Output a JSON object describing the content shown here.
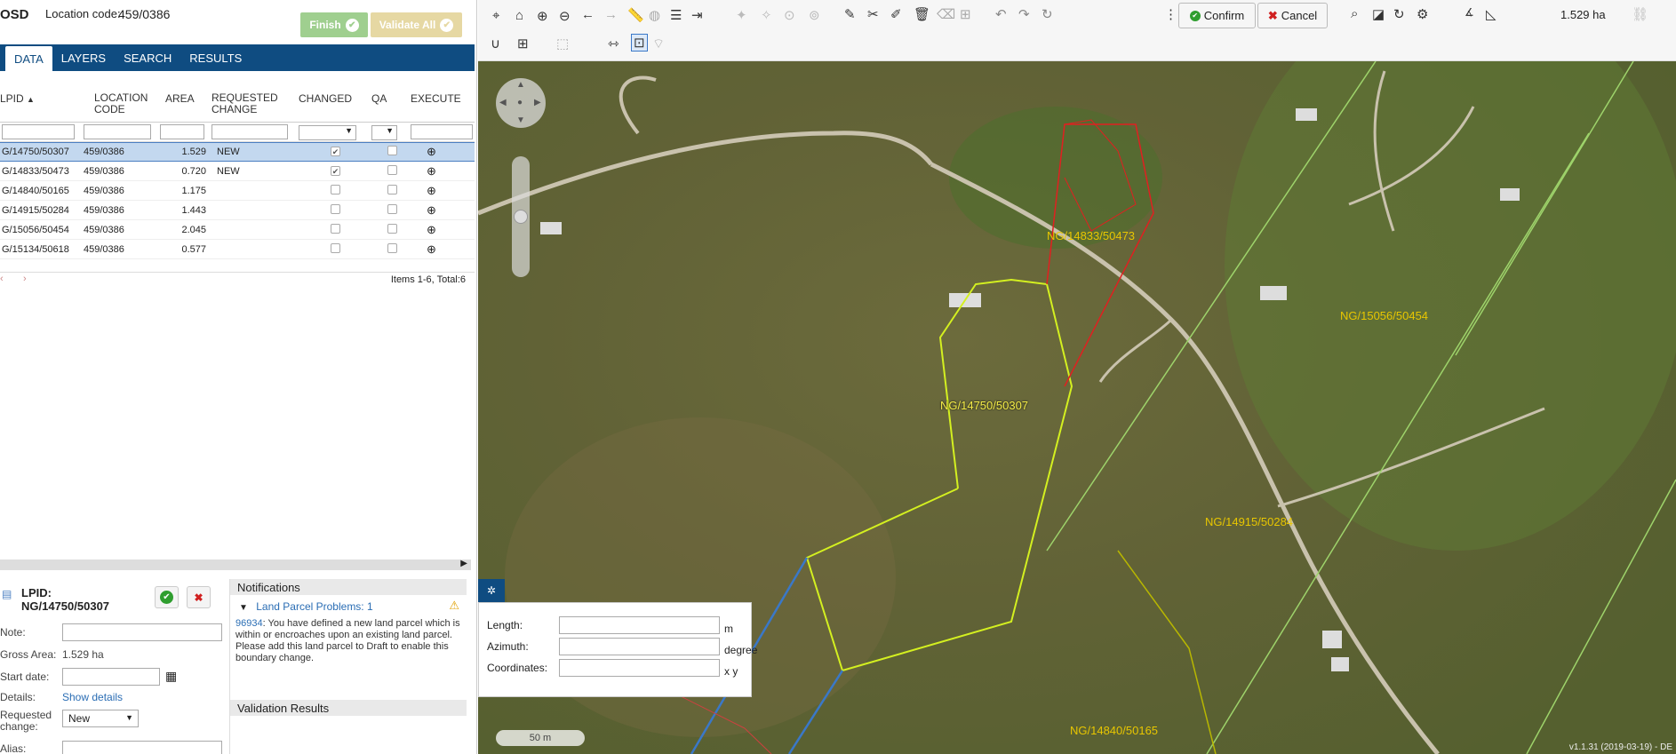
{
  "app": {
    "name": "OSD",
    "location_label": "Location code:",
    "location_code": "459/0386"
  },
  "actions": {
    "finish": "Finish",
    "validate_all": "Validate All"
  },
  "tabs": [
    "DATA",
    "LAYERS",
    "SEARCH",
    "RESULTS"
  ],
  "grid": {
    "columns": [
      "LPID",
      "LOCATION CODE",
      "AREA",
      "REQUESTED CHANGE",
      "CHANGED",
      "QA",
      "EXECUTE"
    ],
    "rows": [
      {
        "lpid": "G/14750/50307",
        "loc": "459/0386",
        "area": "1.529",
        "req": "NEW",
        "changed": true,
        "qa": false
      },
      {
        "lpid": "G/14833/50473",
        "loc": "459/0386",
        "area": "0.720",
        "req": "NEW",
        "changed": true,
        "qa": false
      },
      {
        "lpid": "G/14840/50165",
        "loc": "459/0386",
        "area": "1.175",
        "req": "",
        "changed": false,
        "qa": false
      },
      {
        "lpid": "G/14915/50284",
        "loc": "459/0386",
        "area": "1.443",
        "req": "",
        "changed": false,
        "qa": false
      },
      {
        "lpid": "G/15056/50454",
        "loc": "459/0386",
        "area": "2.045",
        "req": "",
        "changed": false,
        "qa": false
      },
      {
        "lpid": "G/15134/50618",
        "loc": "459/0386",
        "area": "0.577",
        "req": "",
        "changed": false,
        "qa": false
      }
    ],
    "items_text": "Items 1-6, Total:6"
  },
  "detail": {
    "title_label": "LPID:",
    "title_value": "NG/14750/50307",
    "note_label": "Note:",
    "gross_label": "Gross Area:",
    "gross_value": "1.529 ha",
    "start_label": "Start date:",
    "details_label": "Details:",
    "details_link": "Show details",
    "req_label": "Requested change:",
    "req_value": "New",
    "alias_label": "Alias:"
  },
  "notifications": {
    "title": "Notifications",
    "problems": "Land Parcel Problems: 1",
    "code": "96934",
    "message": ": You have defined a new land parcel which is within or encroaches upon an existing land parcel. Please add this land parcel to Draft to enable this boundary change.",
    "validation": "Validation Results"
  },
  "map_toolbar": {
    "confirm": "Confirm",
    "cancel": "Cancel",
    "area": "1.529 ha"
  },
  "measure": {
    "length": "Length:",
    "length_unit": "m",
    "azimuth": "Azimuth:",
    "azimuth_unit": "degree",
    "coords": "Coordinates:",
    "coords_unit": "x y"
  },
  "map": {
    "labels": [
      "NG/14833/50473",
      "NG/15056/50454",
      "NG/14750/50307",
      "NG/14915/50284",
      "NG/14840/50165"
    ],
    "scale": "50 m",
    "version": "v1.1.31 (2019-03-19) - DE"
  }
}
